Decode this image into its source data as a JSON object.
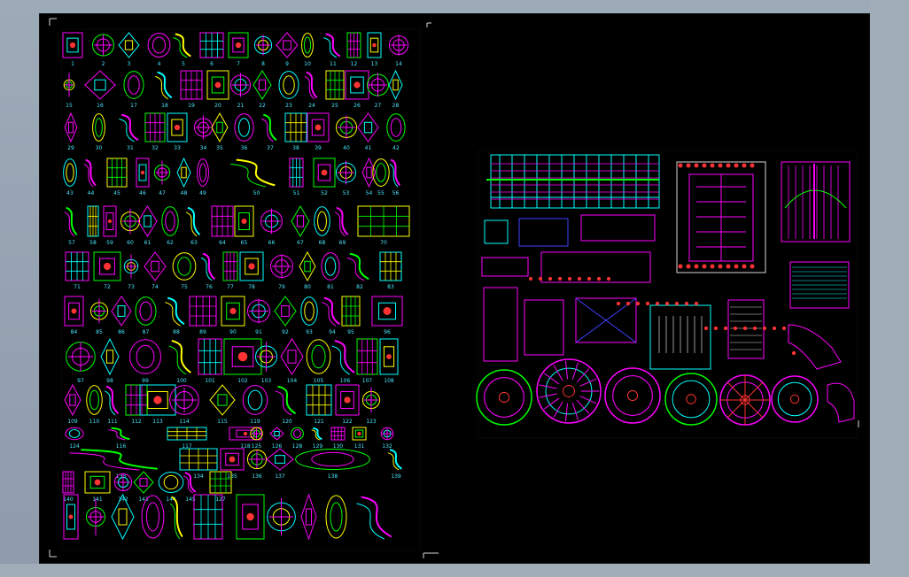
{
  "viewer": {
    "background": "#9aa6b3",
    "canvas_bg": "#000000",
    "accent_colors": [
      "#ff00ff",
      "#00ff00",
      "#00ffff",
      "#ffff00",
      "#ff0000"
    ]
  },
  "sheet": {
    "labels": [
      "1",
      "2",
      "3",
      "4",
      "5",
      "6",
      "7",
      "8",
      "9",
      "10",
      "11",
      "12",
      "13",
      "14",
      "15",
      "16",
      "17",
      "18",
      "19",
      "20",
      "21",
      "22",
      "23",
      "24",
      "25",
      "26",
      "27",
      "28",
      "29",
      "30",
      "31",
      "32",
      "33",
      "34",
      "35",
      "36",
      "37",
      "38",
      "39",
      "40",
      "41",
      "42",
      "43",
      "44",
      "45",
      "46",
      "47",
      "48",
      "49",
      "50",
      "51",
      "52",
      "53",
      "54",
      "55",
      "56",
      "57",
      "58",
      "59",
      "60",
      "61",
      "62",
      "63",
      "64",
      "65",
      "66",
      "67",
      "68",
      "69",
      "70",
      "71",
      "72",
      "73",
      "74",
      "75",
      "76",
      "77",
      "78",
      "79",
      "80",
      "81",
      "82",
      "83",
      "84",
      "85",
      "86",
      "87",
      "88",
      "89",
      "90",
      "91",
      "92",
      "93",
      "94",
      "95",
      "96",
      "97",
      "98",
      "99",
      "100",
      "101",
      "102",
      "103",
      "104",
      "105",
      "106",
      "107",
      "108",
      "109",
      "110",
      "111",
      "112",
      "113",
      "114",
      "115",
      "119",
      "120",
      "121",
      "122",
      "123",
      "124",
      "116",
      "117",
      "118",
      "125",
      "126",
      "128",
      "129",
      "130",
      "131",
      "132",
      "133",
      "134",
      "135",
      "136",
      "137",
      "138",
      "139",
      "140",
      "141",
      "142",
      "143",
      "144",
      "145",
      "127"
    ]
  },
  "icons": {
    "viewer_icon": "cad-viewer",
    "corner_marker": "corner-marker-icon"
  }
}
